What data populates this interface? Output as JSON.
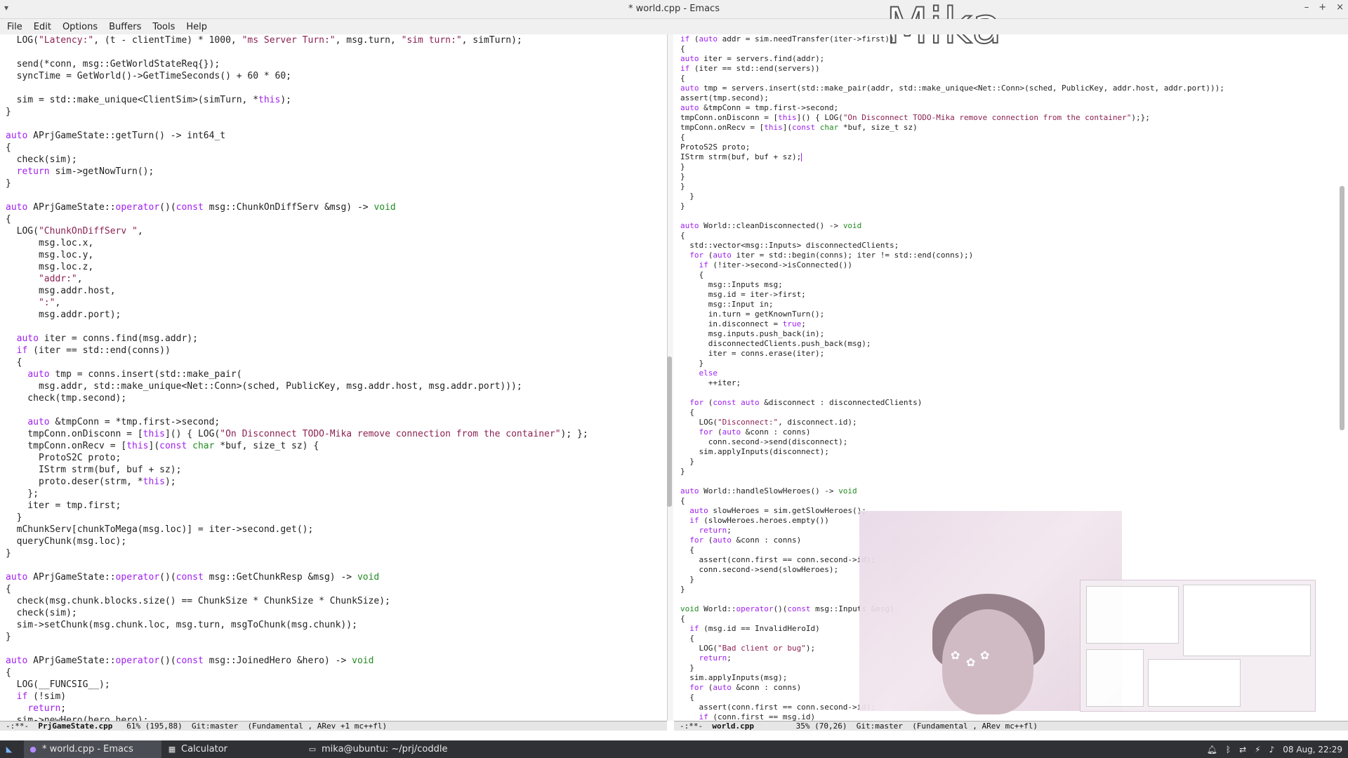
{
  "window": {
    "title": "* world.cpp - Emacs",
    "watermark": "Mika",
    "controls": [
      "–",
      "+",
      "×"
    ]
  },
  "menubar": [
    "File",
    "Edit",
    "Options",
    "Buffers",
    "Tools",
    "Help"
  ],
  "left_buffer": {
    "filename": "PrjGameState.cpp",
    "modeline": {
      "status": "-:**-",
      "filename": "PrjGameState.cpp",
      "position": "61% (195,88)",
      "vc": "Git:master",
      "modes": "(Fundamental , ARev +1 mc++fl)"
    }
  },
  "right_buffer": {
    "filename": "world.cpp",
    "modeline": {
      "status": "-:**-",
      "filename": "world.cpp",
      "position": "35% (70,26)",
      "vc": "Git:master",
      "modes": "(Fundamental , ARev mc++fl)"
    }
  },
  "taskbar": {
    "items": [
      {
        "label": "* world.cpp - Emacs",
        "icon": "emacs-icon",
        "active": true
      },
      {
        "label": "Calculator",
        "icon": "calculator-icon",
        "active": false
      },
      {
        "label": "mika@ubuntu: ~/prj/coddle",
        "icon": "terminal-icon",
        "active": false
      }
    ],
    "clock": "08 Aug, 22:29",
    "tray_icons": [
      "bell-icon",
      "bluetooth-icon",
      "network-icon",
      "power-icon",
      "volume-icon"
    ]
  },
  "colors": {
    "keyword": "#a020f0",
    "string": "#8b2252",
    "type": "#228b22",
    "taskbar_bg": "#2f3135"
  }
}
